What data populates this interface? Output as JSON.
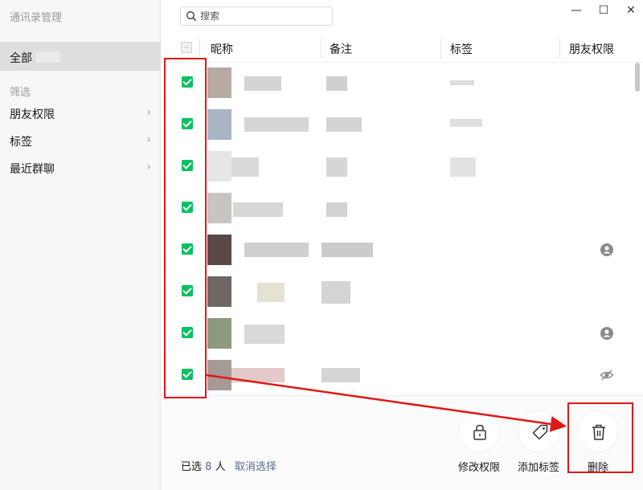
{
  "sidebar": {
    "app_title": "通讯录管理",
    "all_label": "全部",
    "filter_heading": "筛选",
    "items": [
      {
        "label": "朋友权限",
        "chevron": "›"
      },
      {
        "label": "标签",
        "chevron": "›"
      },
      {
        "label": "最近群聊",
        "chevron": "›"
      }
    ]
  },
  "search": {
    "placeholder": "搜索",
    "icon": "search-icon"
  },
  "window_controls": {
    "minimize": "—",
    "maximize": "☐",
    "close": "✕"
  },
  "table": {
    "columns": [
      "昵称",
      "备注",
      "标签",
      "朋友权限"
    ],
    "rows": [
      {
        "checked": true,
        "permission_icon": null
      },
      {
        "checked": true,
        "permission_icon": null
      },
      {
        "checked": true,
        "permission_icon": null
      },
      {
        "checked": true,
        "permission_icon": null
      },
      {
        "checked": true,
        "permission_icon": "user-icon"
      },
      {
        "checked": true,
        "permission_icon": null
      },
      {
        "checked": true,
        "permission_icon": "user-icon"
      },
      {
        "checked": true,
        "permission_icon": "eye-off-icon"
      }
    ]
  },
  "bottom_bar": {
    "selected_prefix": "已选",
    "selected_count": "8",
    "selected_suffix": "人",
    "cancel_selection": "取消选择",
    "actions": [
      {
        "label": "修改权限",
        "icon": "lock-icon"
      },
      {
        "label": "添加标签",
        "icon": "tag-icon"
      },
      {
        "label": "删除",
        "icon": "trash-icon"
      }
    ]
  },
  "colors": {
    "checkbox_green": "#07c160",
    "link_blue": "#576b95",
    "annotation_red": "#e01818",
    "sidebar_bg": "#f7f7f7",
    "selected_nav_bg": "#dedede"
  }
}
